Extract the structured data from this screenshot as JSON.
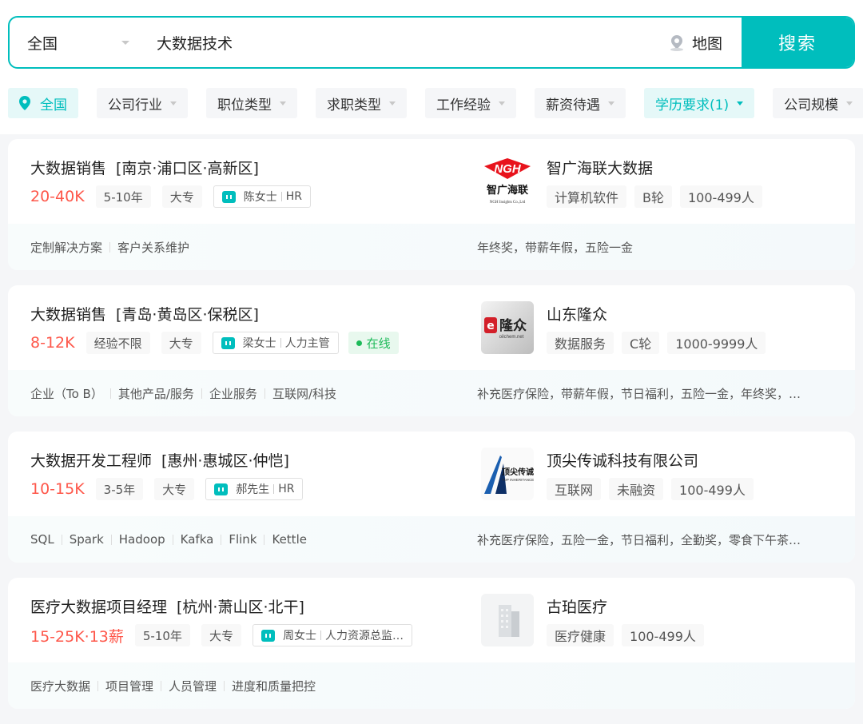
{
  "search": {
    "city": "全国",
    "query": "大数据技术",
    "map_label": "地图",
    "button": "搜索"
  },
  "filters": [
    {
      "label": "全国",
      "active": true
    },
    {
      "label": "公司行业"
    },
    {
      "label": "职位类型"
    },
    {
      "label": "求职类型"
    },
    {
      "label": "工作经验"
    },
    {
      "label": "薪资待遇"
    },
    {
      "label": "学历要求(1)",
      "active": true
    },
    {
      "label": "公司规模"
    }
  ],
  "jobs": [
    {
      "title": "大数据销售",
      "location": "[南京·浦口区·高新区]",
      "salary": "20-40K",
      "experience": "5-10年",
      "education": "大专",
      "boss_name": "陈女士",
      "boss_role": "HR",
      "company": "智广海联大数据",
      "company_tags": [
        "计算机软件",
        "B轮",
        "100-499人"
      ],
      "skills": [
        "定制解决方案",
        "客户关系维护"
      ],
      "welfare": "年终奖，带薪年假，五险一金",
      "logo": {
        "type": "ngh",
        "text": "NGH",
        "subtext": "智广海联",
        "caption": "NGH Insights Co.,Ltd"
      }
    },
    {
      "title": "大数据销售",
      "location": "[青岛·黄岛区·保税区]",
      "salary": "8-12K",
      "experience": "经验不限",
      "education": "大专",
      "boss_name": "梁女士",
      "boss_role": "人力主管",
      "online": "在线",
      "company": "山东隆众",
      "company_tags": [
        "数据服务",
        "C轮",
        "1000-9999人"
      ],
      "skills": [
        "企业（To B）",
        "其他产品/服务",
        "企业服务",
        "互联网/科技"
      ],
      "welfare": "补充医疗保险，带薪年假，节日福利，五险一金，年终奖，…",
      "logo": {
        "type": "longzhong",
        "text": "隆众",
        "caption": "oilchem.net"
      }
    },
    {
      "title": "大数据开发工程师",
      "location": "[惠州·惠城区·仲恺]",
      "salary": "10-15K",
      "experience": "3-5年",
      "education": "大专",
      "boss_name": "郝先生",
      "boss_role": "HR",
      "company": "顶尖传诚科技有限公司",
      "company_tags": [
        "互联网",
        "未融资",
        "100-499人"
      ],
      "skills": [
        "SQL",
        "Spark",
        "Hadoop",
        "Kafka",
        "Flink",
        "Kettle"
      ],
      "welfare": "补充医疗保险，五险一金，节日福利，全勤奖，零食下午茶…",
      "logo": {
        "type": "dingjian",
        "text": "顶尖传诚",
        "caption": "TOP INHERITANCE"
      }
    },
    {
      "title": "医疗大数据项目经理",
      "location": "[杭州·萧山区·北干]",
      "salary": "15-25K·13薪",
      "experience": "5-10年",
      "education": "大专",
      "boss_name": "周女士",
      "boss_role": "人力资源总监…",
      "company": "古珀医疗",
      "company_tags": [
        "医疗健康",
        "100-499人"
      ],
      "skills": [
        "医疗大数据",
        "项目管理",
        "人员管理",
        "进度和质量把控"
      ],
      "welfare": "",
      "logo": {
        "type": "building"
      }
    }
  ],
  "colors": {
    "accent": "#00bebd",
    "salary": "#fe574a",
    "online": "#1dba59"
  }
}
